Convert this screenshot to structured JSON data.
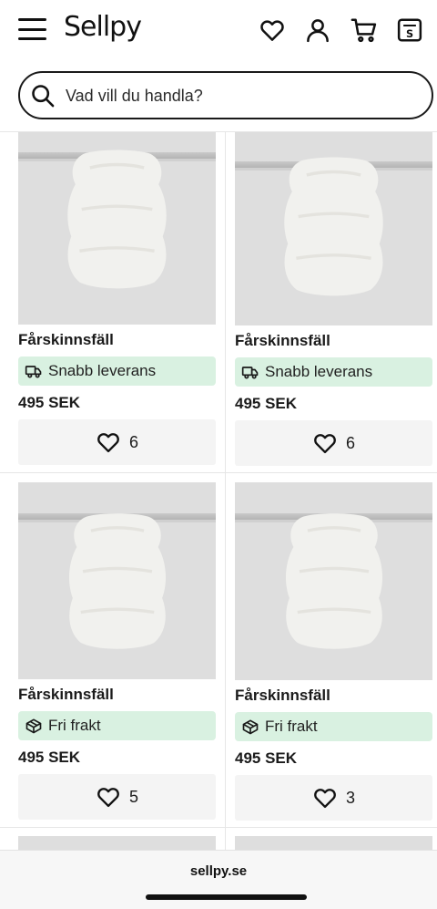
{
  "header": {
    "logo": "Sellpy"
  },
  "search": {
    "placeholder": "Vad vill du handla?"
  },
  "products": [
    {
      "title": "Fårskinnsfäll",
      "badge": "Snabb leverans",
      "badge_icon": "truck-icon",
      "price": "495 SEK",
      "likes": "6"
    },
    {
      "title": "Fårskinnsfäll",
      "badge": "Snabb leverans",
      "badge_icon": "truck-icon",
      "price": "495 SEK",
      "likes": "6"
    },
    {
      "title": "Fårskinnsfäll",
      "badge": "Fri frakt",
      "badge_icon": "package-icon",
      "price": "495 SEK",
      "likes": "5"
    },
    {
      "title": "Fårskinnsfäll",
      "badge": "Fri frakt",
      "badge_icon": "package-icon",
      "price": "495 SEK",
      "likes": "3"
    }
  ],
  "footer": {
    "url": "sellpy.se"
  },
  "colors": {
    "badge_bg": "#d9f1e1",
    "likes_bg": "#f4f4f4",
    "photo_bg": "#dedede"
  }
}
